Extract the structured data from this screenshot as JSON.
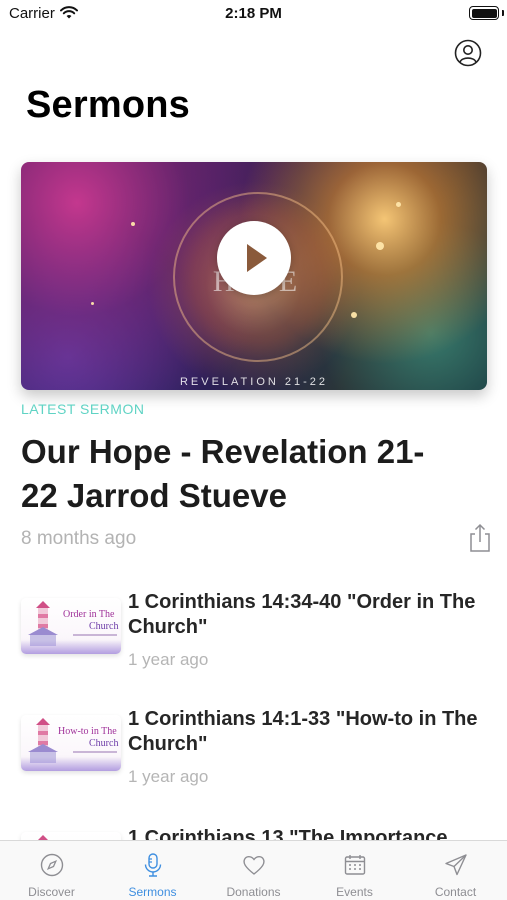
{
  "status_bar": {
    "carrier": "Carrier",
    "time": "2:18 PM"
  },
  "header": {
    "title": "Sermons",
    "profile_icon": "person-circle-icon"
  },
  "latest": {
    "label": "LATEST SERMON",
    "title": "Our Hope - Revelation 21-22 Jarrod Stueve",
    "date": "8 months ago",
    "hero_word": "HOPE",
    "hero_caption": "REVELATION 21-22",
    "play_icon": "play-icon",
    "share_icon": "share-icon"
  },
  "sermons": [
    {
      "title": "1 Corinthians 14:34-40 \"Order in The Church\"",
      "date": "1 year ago",
      "thumb_line1": "Order in The",
      "thumb_line2": "Church"
    },
    {
      "title": "1 Corinthians 14:1-33 \"How-to in The Church\"",
      "date": "1 year ago",
      "thumb_line1": "How-to in The",
      "thumb_line2": "Church"
    },
    {
      "title": "1 Corinthians 13 \"The Importance",
      "date": "",
      "thumb_line1": "",
      "thumb_line2": ""
    }
  ],
  "tabs": [
    {
      "label": "Discover",
      "icon": "compass-icon",
      "active": false
    },
    {
      "label": "Sermons",
      "icon": "microphone-icon",
      "active": true
    },
    {
      "label": "Donations",
      "icon": "heart-icon",
      "active": false
    },
    {
      "label": "Events",
      "icon": "calendar-icon",
      "active": false
    },
    {
      "label": "Contact",
      "icon": "paper-plane-icon",
      "active": false
    }
  ],
  "colors": {
    "accent": "#3f8fe0",
    "latest_label": "#5fd3c4",
    "muted_text": "#b3b3b3"
  }
}
